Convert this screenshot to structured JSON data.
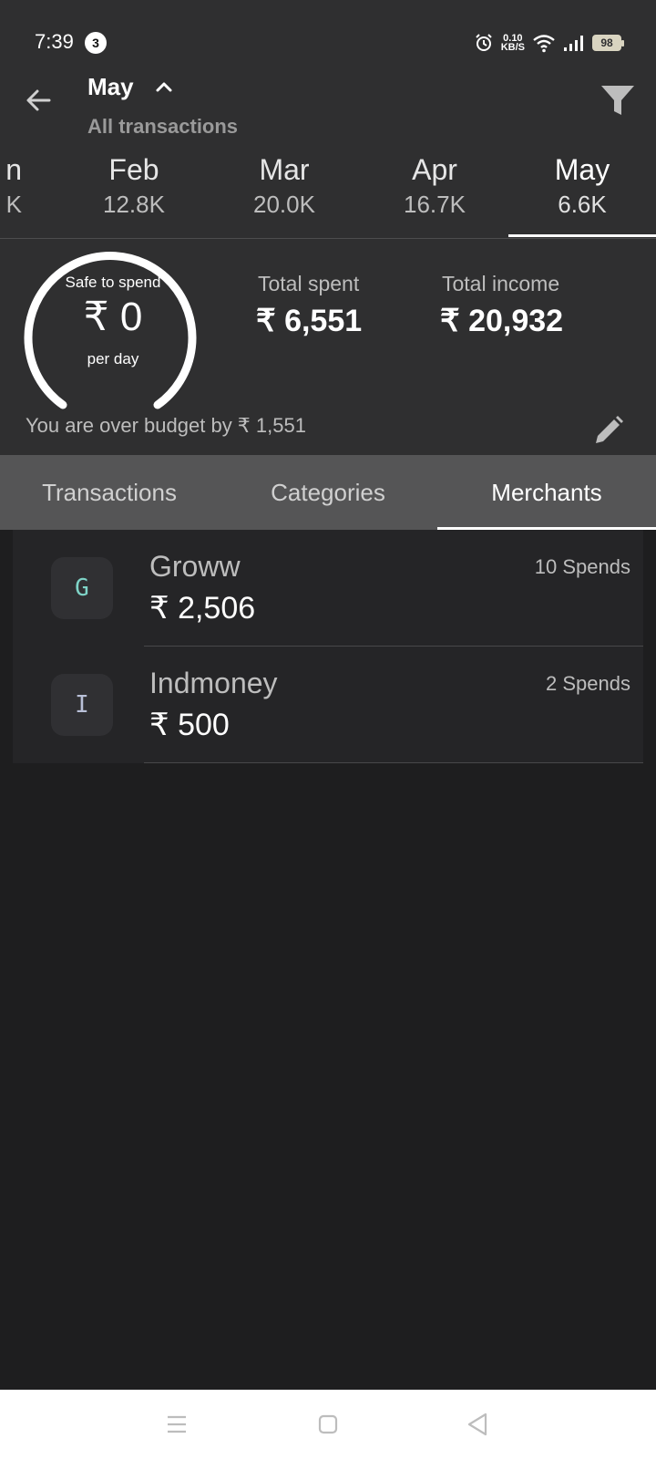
{
  "status_bar": {
    "time": "7:39",
    "notification_count": "3",
    "net_speed_value": "0.10",
    "net_speed_unit": "KB/S",
    "battery": "98"
  },
  "header": {
    "title": "May",
    "subtitle": "All transactions"
  },
  "months": [
    {
      "name": "Jan",
      "value": "K"
    },
    {
      "name": "Feb",
      "value": "12.8K"
    },
    {
      "name": "Mar",
      "value": "20.0K"
    },
    {
      "name": "Apr",
      "value": "16.7K"
    },
    {
      "name": "May",
      "value": "6.6K"
    }
  ],
  "months_partial_first": {
    "name": "n",
    "value": "K"
  },
  "summary": {
    "safe_label": "Safe to spend",
    "safe_value": "₹ 0",
    "safe_unit": "per day",
    "spent_label": "Total spent",
    "spent_value": "₹ 6,551",
    "income_label": "Total income",
    "income_value": "₹ 20,932",
    "budget_message": "You are over budget by ₹ 1,551"
  },
  "section_tabs": [
    {
      "label": "Transactions"
    },
    {
      "label": "Categories"
    },
    {
      "label": "Merchants"
    }
  ],
  "merchants": [
    {
      "initial": "G",
      "name": "Groww",
      "amount": "₹ 2,506",
      "count": "10 Spends",
      "initial_color": "#7fd4c8"
    },
    {
      "initial": "I",
      "name": "Indmoney",
      "amount": "₹ 500",
      "count": "2 Spends",
      "initial_color": "#b9c0d8"
    }
  ],
  "colors": {
    "header_bg": "#2f2f30",
    "tab_bar_bg": "#555556",
    "list_bg": "#252527",
    "page_bg": "#1e1e1f"
  }
}
